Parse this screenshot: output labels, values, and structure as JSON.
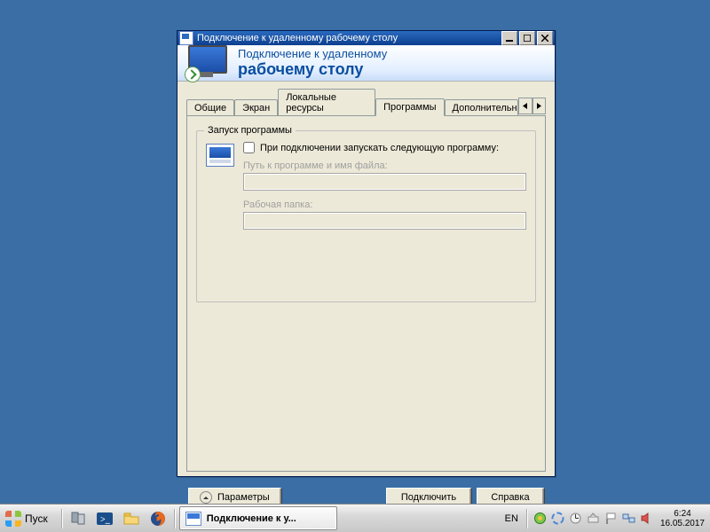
{
  "window": {
    "title": "Подключение к удаленному рабочему столу"
  },
  "banner": {
    "line1": "Подключение к удаленному",
    "line2": "рабочему столу"
  },
  "tabs": {
    "t1": "Общие",
    "t2": "Экран",
    "t3": "Локальные ресурсы",
    "t4": "Программы",
    "t5": "Дополнительн"
  },
  "group": {
    "legend": "Запуск программы",
    "checkbox_label": "При подключении запускать следующую программу:",
    "path_label": "Путь к программе и имя файла:",
    "folder_label": "Рабочая папка:"
  },
  "buttons": {
    "options": "Параметры",
    "connect": "Подключить",
    "help": "Справка"
  },
  "taskbar": {
    "start": "Пуск",
    "task_title": "Подключение к у...",
    "lang": "EN",
    "time": "6:24",
    "date": "16.05.2017"
  }
}
